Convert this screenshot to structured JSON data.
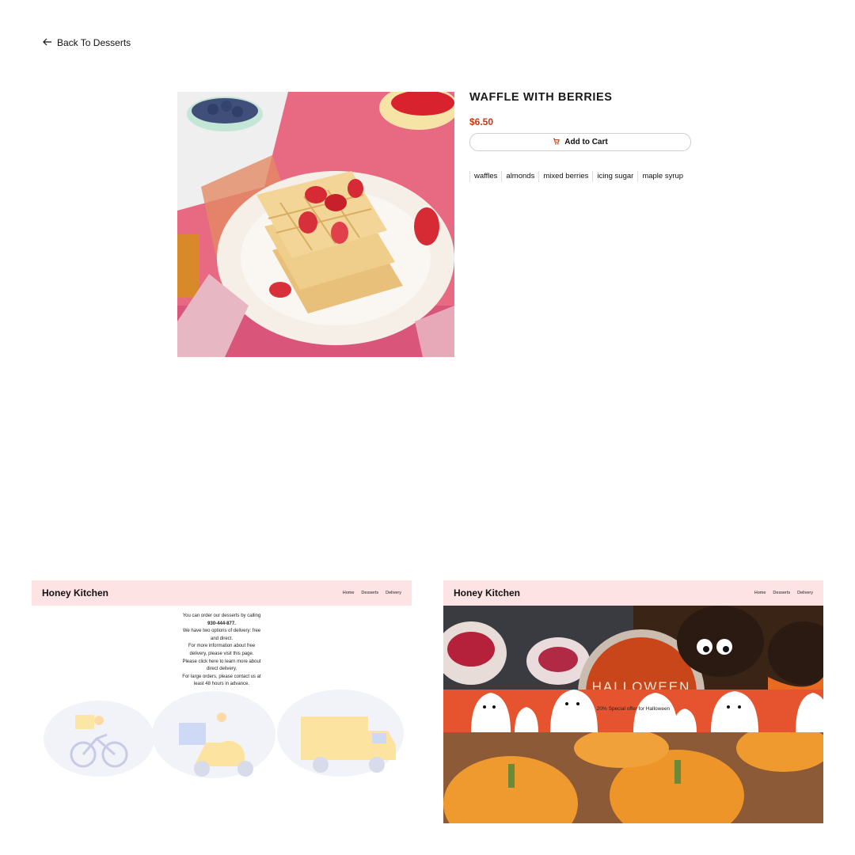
{
  "nav": {
    "back_label": "Back To Desserts"
  },
  "product": {
    "title": "WAFFLE WITH BERRIES",
    "price": "$6.50",
    "cart_label": "Add to Cart",
    "tags": [
      "waffles",
      "almonds",
      "mixed berries",
      "icing sugar",
      "maple syrup"
    ]
  },
  "delivery_card": {
    "brand": "Honey Kitchen",
    "nav": [
      "Home",
      "Desserts",
      "Delivery"
    ],
    "lines": [
      "You can order our desserts by calling",
      "930-444-877.",
      "We have two options of delivery: free",
      "and direct.",
      "For more information about free",
      "delivery, please visit this page.",
      "Please click here to learn more about",
      "direct delivery.",
      "For large orders, please contact us at",
      "least 48 hours in advance."
    ]
  },
  "halloween_card": {
    "brand": "Honey Kitchen",
    "nav": [
      "Home",
      "Desserts",
      "Delivery"
    ],
    "sign": "HALLOWEEN",
    "promo": "20% Special offer for Halloween"
  },
  "colors": {
    "accent": "#c53a11",
    "header_pink": "#fde3e4",
    "promo_orange": "#e5532f"
  },
  "icons": {
    "back": "arrow-left-icon",
    "cart": "cart-icon"
  }
}
